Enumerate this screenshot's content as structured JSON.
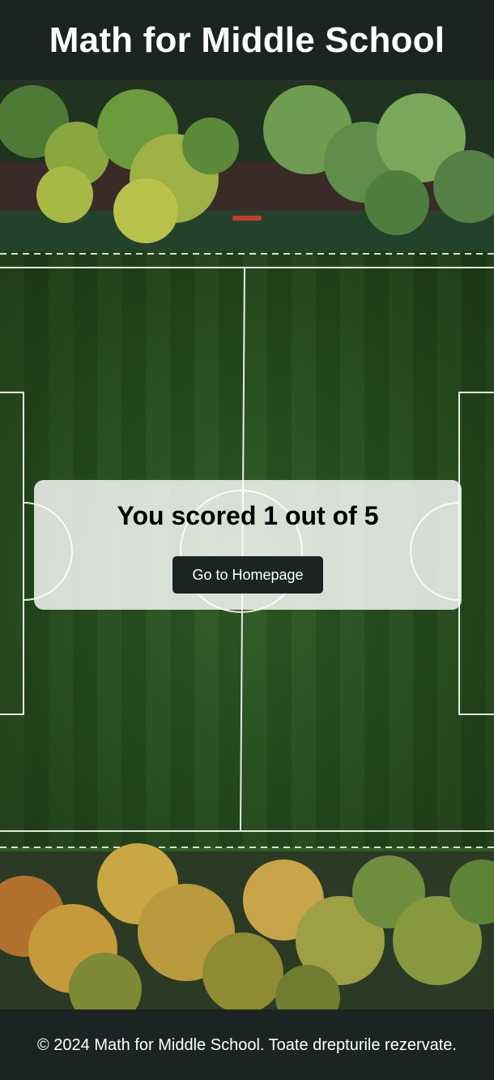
{
  "header": {
    "title": "Math for Middle School"
  },
  "result": {
    "score_text": "You scored 1 out of 5",
    "home_button_label": "Go to Homepage"
  },
  "footer": {
    "copyright": "© 2024 Math for Middle School. Toate drepturile rezervate."
  },
  "colors": {
    "dark_bar": "#1c2323",
    "grass": "#2f5a25",
    "card_bg": "rgba(255,255,255,0.82)",
    "button_bg": "#1c2323"
  }
}
